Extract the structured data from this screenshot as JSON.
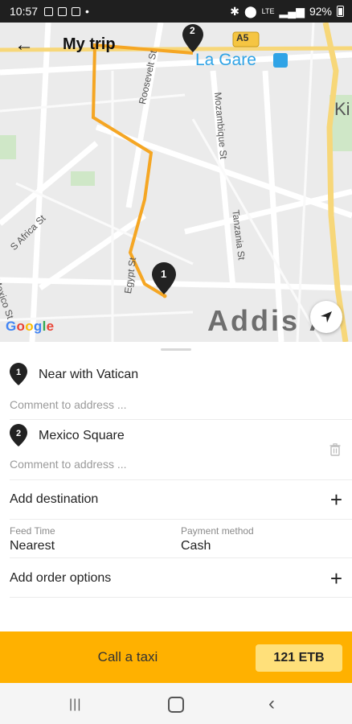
{
  "status_bar": {
    "time": "10:57",
    "battery": "92%",
    "lte": "LTE"
  },
  "header": {
    "title": "My trip",
    "back_icon": "arrow-left-icon"
  },
  "map": {
    "road_label_a5": "A5",
    "place_la_gare": "La Gare",
    "streets": [
      "Roosevelt St",
      "Mozambique St",
      "Tanzania St",
      "Egypt St",
      "S Africa St",
      "Mexico St"
    ],
    "city_label": "Addis A",
    "side_label_ki": "Ki",
    "pin1": "1",
    "pin2": "2",
    "google": [
      "G",
      "o",
      "o",
      "g",
      "l",
      "e"
    ],
    "google_colors": [
      "#4285F4",
      "#EA4335",
      "#FBBC05",
      "#4285F4",
      "#34A853",
      "#EA4335"
    ],
    "route_color": "#F5A623"
  },
  "stops": [
    {
      "number": "1",
      "name": "Near with Vatican",
      "comment_placeholder": "Comment to address ..."
    },
    {
      "number": "2",
      "name": "Mexico Square",
      "comment_placeholder": "Comment to address ..."
    }
  ],
  "add_destination": "Add destination",
  "feed_time": {
    "label": "Feed Time",
    "value": "Nearest"
  },
  "payment": {
    "label": "Payment method",
    "value": "Cash"
  },
  "add_order_options": "Add order options",
  "call": {
    "label": "Call a taxi",
    "price": "121 ETB"
  },
  "colors": {
    "accent": "#FFB100",
    "price_bg": "#FFE07A"
  }
}
